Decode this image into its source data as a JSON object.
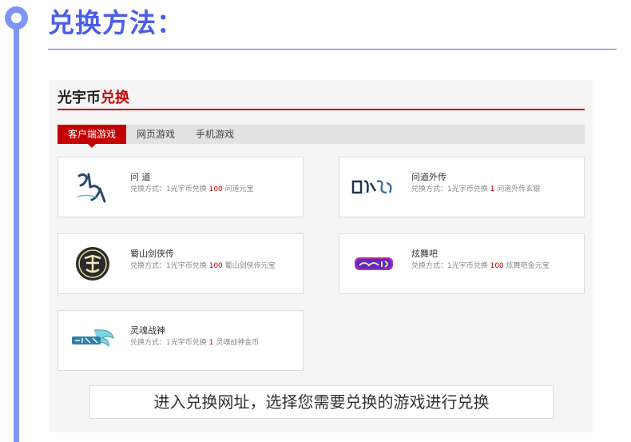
{
  "section": {
    "title": "兑换方法："
  },
  "panel": {
    "header_main": "光宇币",
    "header_accent": "兑换",
    "tabs": [
      {
        "label": "客户端游戏",
        "active": true
      },
      {
        "label": "网页游戏",
        "active": false
      },
      {
        "label": "手机游戏",
        "active": false
      }
    ]
  },
  "games": [
    {
      "name": "问 道",
      "desc_prefix": "兑换方式：1光宇币兑换 ",
      "rate": "100",
      "desc_suffix": " 问道元宝",
      "logo_icon": "wendao-logo-icon"
    },
    {
      "name": "问道外传",
      "desc_prefix": "兑换方式：1光宇币兑换 ",
      "rate": "1",
      "desc_suffix": " 问道外传玄银",
      "logo_icon": "wendao-waizhuan-logo-icon"
    },
    {
      "name": "蜀山剑侠传",
      "desc_prefix": "兑换方式：1光宇币兑换 ",
      "rate": "100",
      "desc_suffix": " 蜀山剑侠传元宝",
      "logo_icon": "shushan-logo-icon"
    },
    {
      "name": "炫舞吧",
      "desc_prefix": "兑换方式：1光宇币兑换 ",
      "rate": "100",
      "desc_suffix": " 炫舞吧金元宝",
      "logo_icon": "xuanwuba-logo-icon"
    },
    {
      "name": "灵魂战神",
      "desc_prefix": "兑换方式：1光宇币兑换 ",
      "rate": "1",
      "desc_suffix": " 灵魂战神金币",
      "logo_icon": "linghun-logo-icon"
    }
  ],
  "caption": "进入兑换网址，选择您需要兑换的游戏进行兑换",
  "colors": {
    "accent_red": "#c40000",
    "timeline_blue": "#7e95f2",
    "title_blue": "#4a5fe6"
  }
}
